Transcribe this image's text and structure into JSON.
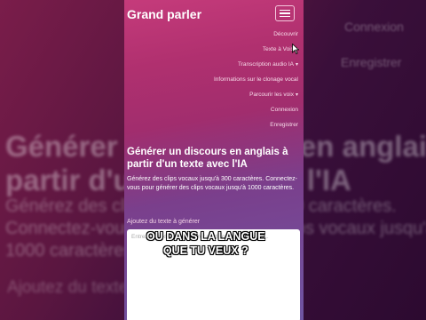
{
  "brand": "Grand parler",
  "menu": {
    "items": [
      {
        "label": "Découvrir"
      },
      {
        "label": "Texte à Voix",
        "chevron": true
      },
      {
        "label": "Transcription audio IA",
        "chevron": true
      },
      {
        "label": "Informations sur le clonage vocal"
      },
      {
        "label": "Parcourir les voix",
        "chevron": true
      },
      {
        "label": "Connexion"
      },
      {
        "label": "Enregistrer"
      }
    ]
  },
  "hero": {
    "title": "Générer un discours en anglais à partir d'un texte avec l'IA",
    "description": "Générez des clips vocaux jusqu'à 300 caractères. Connectez-vous pour générer des clips vocaux jusqu'à 1000 caractères."
  },
  "input": {
    "label": "Ajoutez du texte à générer",
    "placeholder": "Entrez du texte pour générer un discours en anglais..."
  },
  "caption": {
    "line1": "OU DANS LA LANGUE",
    "line2": "QUE TU VEUX ?"
  },
  "background": {
    "title_line1": "Générer un discours en anglais à",
    "title_line2": "partir d'un texte avec l'IA",
    "desc_line1": "Générez des clips vocaux jusqu'à 300 caractères.",
    "desc_line2": "Connectez-vous pour générer des clips vocaux jusqu'à",
    "desc_line3": "1000 caractères.",
    "link_connexion": "Connexion",
    "link_enregistrer": "Enregistrer",
    "add_text": "Ajoutez du texte à générer"
  }
}
